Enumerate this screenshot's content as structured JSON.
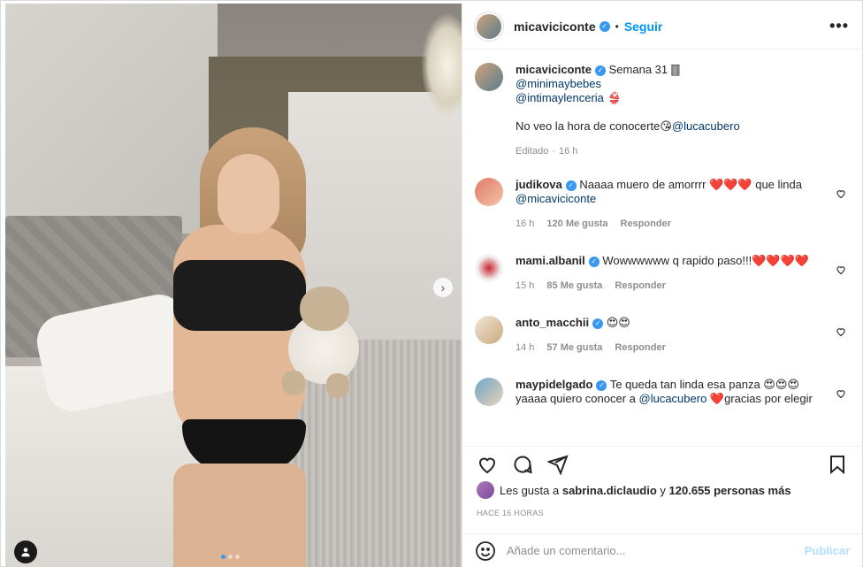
{
  "post": {
    "username": "micaviciconte",
    "follow_label": "Seguir",
    "separator": "•",
    "more_label": "•••"
  },
  "caption": {
    "username": "micaviciconte",
    "line1": "Semana 31 🀫",
    "mention1": "@minimaybebes",
    "mention2": "@intimaylenceria",
    "mention2_suffix": " 👙",
    "body": "No veo la hora de conocerte😘",
    "body_mention": "@lucacubero",
    "edited": "Editado",
    "time": "16 h"
  },
  "comments": [
    {
      "username": "judikova",
      "text": "Naaaa muero de amorrrr ❤️❤️❤️ que linda",
      "mention": "@micaviciconte",
      "time": "16 h",
      "likes": "120 Me gusta",
      "reply": "Responder"
    },
    {
      "username": "mami.albanil",
      "text": "Wowwwwww q rapido paso!!!❤️❤️❤️❤️",
      "time": "15 h",
      "likes": "85 Me gusta",
      "reply": "Responder"
    },
    {
      "username": "anto_macchii",
      "text": "😍😍",
      "time": "14 h",
      "likes": "57 Me gusta",
      "reply": "Responder"
    },
    {
      "username": "maypidelgado",
      "text": "Te queda tan linda esa panza 😍😍😍yaaaa quiero conocer a",
      "mention": "@lucacubero",
      "text2": "❤️gracias por elegir"
    }
  ],
  "likes": {
    "prefix": "Les gusta a",
    "user": "sabrina.diclaudio",
    "middle": "y",
    "count": "120.655 personas más"
  },
  "timestamp": "HACE 16 HORAS",
  "add_comment": {
    "placeholder": "Añade un comentario...",
    "post_label": "Publicar"
  },
  "carousel": {
    "total": 3,
    "active_index": 0
  },
  "colors": {
    "accent": "#0095f6",
    "verified": "#3897f0",
    "mention": "#00376b",
    "muted": "#8e8e8e"
  }
}
